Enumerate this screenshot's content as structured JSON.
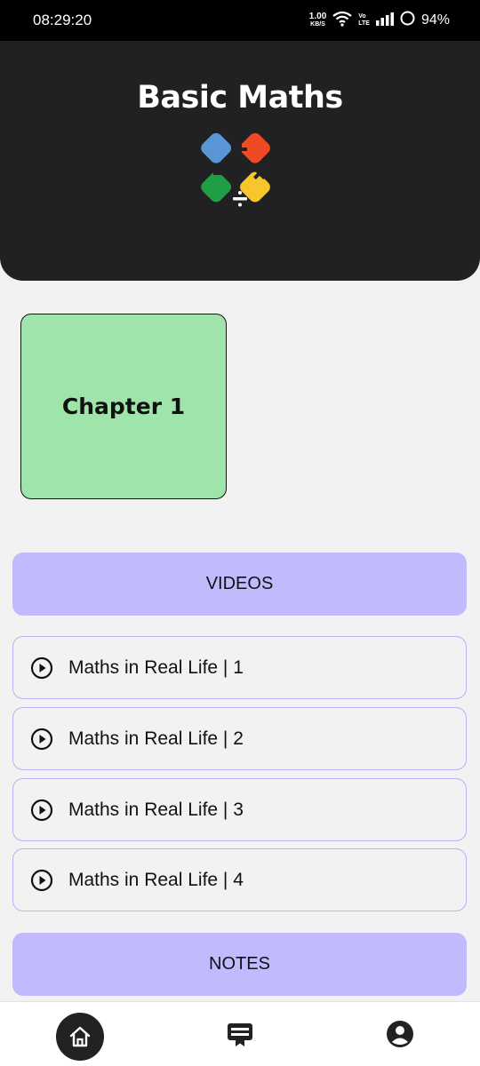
{
  "status_bar": {
    "time": "08:29:20",
    "net_speed_value": "1.00",
    "net_speed_unit": "KB/S",
    "volte_top": "Vo",
    "volte_bottom": "LTE",
    "battery": "94%"
  },
  "header": {
    "title": "Basic Maths",
    "logo_colors": [
      "#f04a24",
      "#f7c62d",
      "#1f9e46",
      "#5a96d6"
    ]
  },
  "chapter": {
    "label": "Chapter 1",
    "color": "#9fe5ab"
  },
  "videos_section": {
    "label": "VIDEOS"
  },
  "videos": [
    {
      "label": "Maths in Real Life | 1"
    },
    {
      "label": "Maths in Real Life | 2"
    },
    {
      "label": "Maths in Real Life | 3"
    },
    {
      "label": "Maths in Real Life | 4"
    }
  ],
  "notes_section": {
    "label": "NOTES"
  },
  "accent_color": "#c1bbfd",
  "bottom_nav": {
    "items": [
      {
        "icon": "home-icon",
        "active": true
      },
      {
        "icon": "notes-icon",
        "active": false
      },
      {
        "icon": "account-icon",
        "active": false
      }
    ]
  }
}
